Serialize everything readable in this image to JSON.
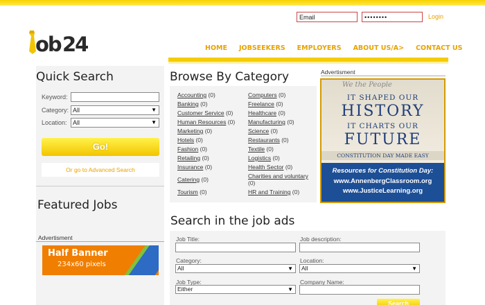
{
  "header": {
    "login": {
      "email_value": "Email",
      "password_value": "••••••••",
      "login_label": "Login"
    },
    "logo_text": "Job24",
    "nav": [
      "HOME",
      "JOBSEEKERS",
      "EMPLOYERS",
      "ABOUT US/A>",
      "CONTACT US"
    ]
  },
  "quick_search": {
    "title": "Quick Search",
    "keyword_label": "Keyword:",
    "category_label": "Category:",
    "category_value": "All",
    "location_label": "Location:",
    "location_value": "All",
    "go_label": "Go!",
    "advanced_link": "Or go to Advanced Search"
  },
  "featured": {
    "title": "Featured Jobs",
    "ad_label": "Advertisment",
    "banner_title": "Half Banner",
    "banner_size": "234x60 pixels"
  },
  "browse": {
    "title": "Browse By Category",
    "col1": [
      {
        "name": "Accounting",
        "count": "(0)"
      },
      {
        "name": "Banking",
        "count": "(0)"
      },
      {
        "name": "Customer Service",
        "count": "(0)"
      },
      {
        "name": "Human Resources",
        "count": "(0)"
      },
      {
        "name": "Marketing",
        "count": "(0)"
      },
      {
        "name": "Hotels",
        "count": "(0)"
      },
      {
        "name": "Fashion",
        "count": "(0)"
      },
      {
        "name": "Retailing",
        "count": "(0)"
      },
      {
        "name": "Insurance",
        "count": "(0)"
      },
      {
        "name": "Catering",
        "count": "(0)"
      },
      {
        "name": "Tourism",
        "count": "(0)"
      }
    ],
    "col2": [
      {
        "name": "Computers",
        "count": "(0)"
      },
      {
        "name": "Freelance",
        "count": "(0)"
      },
      {
        "name": "Healthcare",
        "count": "(0)"
      },
      {
        "name": "Manufacturing",
        "count": "(0)"
      },
      {
        "name": "Science",
        "count": "(0)"
      },
      {
        "name": "Restaurants",
        "count": "(0)"
      },
      {
        "name": "Textile",
        "count": "(0)"
      },
      {
        "name": "Logistics",
        "count": "(0)"
      },
      {
        "name": "Health Sector",
        "count": "(0)"
      },
      {
        "name": "Charities and voluntary",
        "count": "(0)"
      },
      {
        "name": "HR and Training",
        "count": "(0)"
      }
    ]
  },
  "ad_right": {
    "label": "Advertisment",
    "script": "We the People",
    "line1": "IT SHAPED OUR",
    "line2": "HISTORY",
    "line3": "IT CHARTS OUR",
    "line4": "FUTURE",
    "line5": "CONSTITUTION DAY MADE EASY",
    "blue1": "Resources for Constitution Day:",
    "blue2": "www.AnnenbergClassroom.org",
    "blue3": "www.JusticeLearning.org"
  },
  "search_ads": {
    "title": "Search in the job ads",
    "job_title_label": "Job Title:",
    "job_desc_label": "Job description:",
    "category_label": "Category:",
    "category_value": "All",
    "location_label": "Location:",
    "location_value": "All",
    "job_type_label": "Job Type:",
    "job_type_value": "Either",
    "company_label": "Company Name:",
    "search_label": "Search"
  }
}
